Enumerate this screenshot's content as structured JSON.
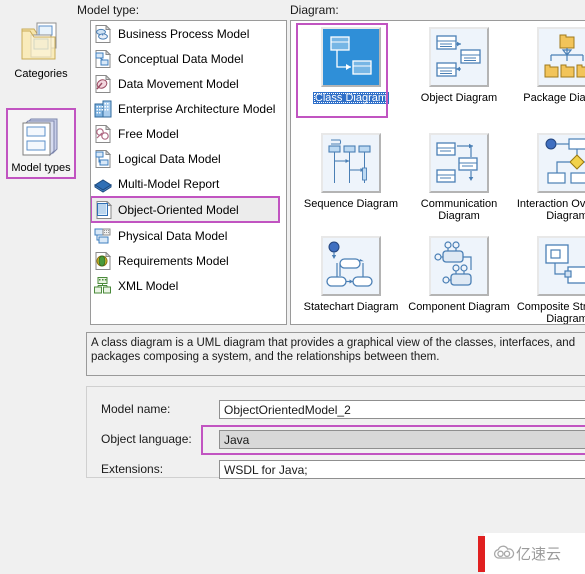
{
  "window": {
    "background_color": "#f0f0f0",
    "highlight_color": "#c154c1",
    "selection_blue": "#2f6fc8"
  },
  "rail": {
    "items": [
      {
        "label": "Categories",
        "icon": "folder-documents-icon",
        "selected": false
      },
      {
        "label": "Model types",
        "icon": "stacked-models-icon",
        "selected": true
      }
    ]
  },
  "labels": {
    "model_type": "Model type:",
    "diagram": "Diagram:"
  },
  "model_type_list": {
    "items": [
      {
        "label": "Business Process Model",
        "icon": "business-process-model-icon",
        "selected": false
      },
      {
        "label": "Conceptual Data Model",
        "icon": "conceptual-data-model-icon",
        "selected": false
      },
      {
        "label": "Data Movement Model",
        "icon": "data-movement-model-icon",
        "selected": false
      },
      {
        "label": "Enterprise Architecture Model",
        "icon": "enterprise-architecture-model-icon",
        "selected": false
      },
      {
        "label": "Free Model",
        "icon": "free-model-icon",
        "selected": false
      },
      {
        "label": "Logical Data Model",
        "icon": "logical-data-model-icon",
        "selected": false
      },
      {
        "label": "Multi-Model Report",
        "icon": "multi-model-report-icon",
        "selected": false
      },
      {
        "label": "Object-Oriented Model",
        "icon": "object-oriented-model-icon",
        "selected": true
      },
      {
        "label": "Physical Data Model",
        "icon": "physical-data-model-icon",
        "selected": false
      },
      {
        "label": "Requirements Model",
        "icon": "requirements-model-icon",
        "selected": false
      },
      {
        "label": "XML Model",
        "icon": "xml-model-icon",
        "selected": false
      }
    ]
  },
  "diagram_panel": {
    "items": [
      {
        "label": "Class Diagram",
        "icon": "class-diagram-icon",
        "selected": true
      },
      {
        "label": "Object Diagram",
        "icon": "object-diagram-icon",
        "selected": false
      },
      {
        "label": "Package Diagram",
        "icon": "package-diagram-icon",
        "selected": false
      },
      {
        "label": "Sequence Diagram",
        "icon": "sequence-diagram-icon",
        "selected": false
      },
      {
        "label": "Communication\nDiagram",
        "icon": "communication-diagram-icon",
        "selected": false
      },
      {
        "label": "Interaction Overview\nDiagram",
        "icon": "interaction-overview-diagram-icon",
        "selected": false
      },
      {
        "label": "Statechart Diagram",
        "icon": "statechart-diagram-icon",
        "selected": false
      },
      {
        "label": "Component Diagram",
        "icon": "component-diagram-icon",
        "selected": false
      },
      {
        "label": "Composite Structure\nDiagram",
        "icon": "composite-structure-diagram-icon",
        "selected": false
      }
    ]
  },
  "description": {
    "text": "A class diagram is a UML diagram that provides a graphical view of the classes, interfaces, and packages composing a system, and the relationships between them."
  },
  "form": {
    "rows": [
      {
        "label": "Model name:",
        "value": "ObjectOrientedModel_2",
        "readonly": false,
        "highlighted": false
      },
      {
        "label": "Object language:",
        "value": "Java",
        "readonly": true,
        "highlighted": true
      },
      {
        "label": "Extensions:",
        "value": "WSDL for Java;",
        "readonly": false,
        "highlighted": false
      }
    ]
  },
  "watermark": {
    "text": "亿速云",
    "icon": "cloud-icon",
    "bar_color": "#e02020"
  }
}
